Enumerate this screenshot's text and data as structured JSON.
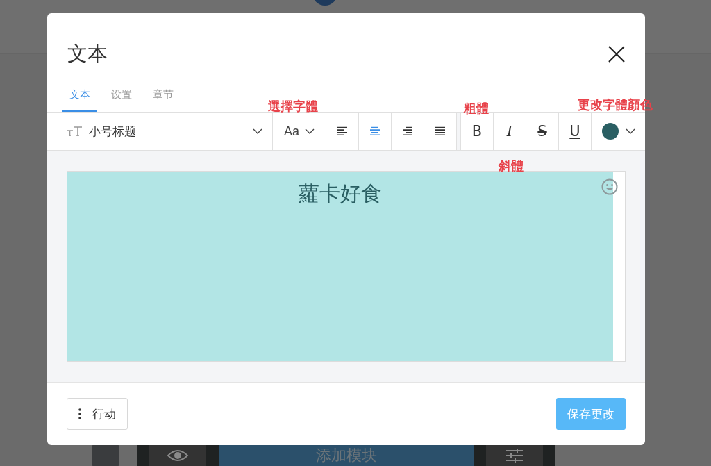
{
  "dialog": {
    "title": "文本",
    "tabs": [
      {
        "label": "文本",
        "selected": true
      },
      {
        "label": "设置",
        "selected": false
      },
      {
        "label": "章节",
        "selected": false
      }
    ],
    "toolbar": {
      "style_select": {
        "value": "小号标题"
      },
      "font_button": {
        "label": "Aa"
      },
      "align_buttons": [
        {
          "kind": "left",
          "selected": false
        },
        {
          "kind": "center",
          "selected": true
        },
        {
          "kind": "right",
          "selected": false
        },
        {
          "kind": "justify",
          "selected": false
        }
      ],
      "format_buttons": [
        {
          "kind": "bold",
          "label": "B"
        },
        {
          "kind": "italic",
          "label": "I"
        },
        {
          "kind": "strike",
          "label": "S"
        },
        {
          "kind": "underline",
          "label": "U"
        }
      ],
      "color_button": {
        "color": "#2a5f63"
      }
    },
    "editor": {
      "text": "蘿卡好食"
    },
    "footer": {
      "actions_button": "行动",
      "save_button": "保存更改"
    }
  },
  "annotations": [
    {
      "kind": "font",
      "text": "選擇字體"
    },
    {
      "kind": "bold",
      "text": "粗體"
    },
    {
      "kind": "color",
      "text": "更改字體顏色"
    },
    {
      "kind": "italic",
      "text": "斜體"
    }
  ],
  "background": {
    "add_module_button": "添加模块"
  }
}
